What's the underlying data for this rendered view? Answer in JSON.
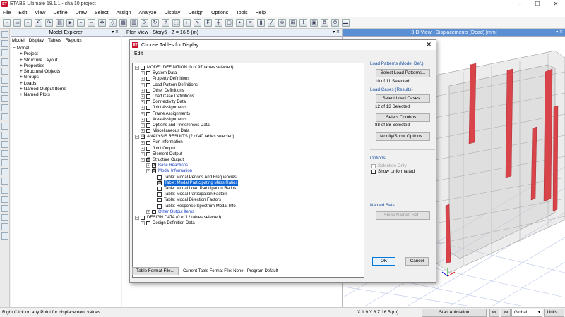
{
  "app": {
    "title": "ETABS Ultimate 18.1.1 - cha 10 project",
    "logo": "ET",
    "win": [
      "–",
      "☐",
      "✕"
    ]
  },
  "menu": [
    "File",
    "Edit",
    "View",
    "Define",
    "Draw",
    "Select",
    "Assign",
    "Analyze",
    "Display",
    "Design",
    "Options",
    "Tools",
    "Help"
  ],
  "toolbar": [
    "new-icon",
    "open-icon",
    "save-icon",
    "undo-icon",
    "redo-icon",
    "lock-icon",
    "run-icon",
    "zoom-in-icon",
    "zoom-out-icon",
    "pan-icon",
    "3d-icon",
    "plan-icon",
    "elevation-icon"
  ],
  "explorer": {
    "title": "Model Explorer",
    "tabs": [
      "Model",
      "Display",
      "Tables",
      "Reports"
    ],
    "items": [
      {
        "exp": "−",
        "label": "Model"
      },
      {
        "exp": "+",
        "label": "Project"
      },
      {
        "exp": "+",
        "label": "Structure Layout"
      },
      {
        "exp": "+",
        "label": "Properties"
      },
      {
        "exp": "+",
        "label": "Structural Objects"
      },
      {
        "exp": "+",
        "label": "Groups"
      },
      {
        "exp": "+",
        "label": "Loads"
      },
      {
        "exp": "+",
        "label": "Named Output Items"
      },
      {
        "exp": "+",
        "label": "Named Plots"
      }
    ]
  },
  "planview": {
    "title": "Plan View - Story5 - Z = 16.5 (m)"
  },
  "view3d": {
    "title": "3-D View  - Displacements (Dead)  [mm]"
  },
  "status": {
    "left": "Right Click on any Point for displacement values",
    "coords": "X 1.9  Y 8  Z 16.5 (m)",
    "animate": "Start Animation",
    "nav_prev": "<<",
    "nav_next": ">>",
    "cs": "Global",
    "units": "Units..."
  },
  "dialog": {
    "logo": "ET",
    "title": "Choose Tables for Display",
    "close": "✕",
    "menu": "Edit",
    "rows": [
      {
        "ind": 0,
        "exp": "−",
        "cb": "",
        "label": "MODEL DEFINITION  (0 of 97 tables selected)",
        "style": ""
      },
      {
        "ind": 1,
        "exp": "+",
        "cb": "",
        "label": "System Data",
        "style": ""
      },
      {
        "ind": 1,
        "exp": "+",
        "cb": "",
        "label": "Property Definitions",
        "style": ""
      },
      {
        "ind": 1,
        "exp": "+",
        "cb": "",
        "label": "Load Pattern Definitions",
        "style": ""
      },
      {
        "ind": 1,
        "exp": "+",
        "cb": "",
        "label": "Other Definitions",
        "style": ""
      },
      {
        "ind": 1,
        "exp": "+",
        "cb": "",
        "label": "Load Case Definitions",
        "style": ""
      },
      {
        "ind": 1,
        "exp": "+",
        "cb": "",
        "label": "Connectivity Data",
        "style": ""
      },
      {
        "ind": 1,
        "exp": "+",
        "cb": "",
        "label": "Joint Assignments",
        "style": ""
      },
      {
        "ind": 1,
        "exp": "+",
        "cb": "",
        "label": "Frame Assignments",
        "style": ""
      },
      {
        "ind": 1,
        "exp": "+",
        "cb": "",
        "label": "Area Assignments",
        "style": ""
      },
      {
        "ind": 1,
        "exp": "+",
        "cb": "",
        "label": "Options and Preferences Data",
        "style": ""
      },
      {
        "ind": 1,
        "exp": "+",
        "cb": "",
        "label": "Miscellaneous Data",
        "style": ""
      },
      {
        "ind": 0,
        "exp": "−",
        "cb": "☒",
        "label": "ANALYSIS RESULTS  (2 of 40 tables selected)",
        "style": ""
      },
      {
        "ind": 1,
        "exp": "+",
        "cb": "",
        "label": "Run Information",
        "style": ""
      },
      {
        "ind": 1,
        "exp": "+",
        "cb": "",
        "label": "Joint Output",
        "style": ""
      },
      {
        "ind": 1,
        "exp": "+",
        "cb": "",
        "label": "Element Output",
        "style": ""
      },
      {
        "ind": 1,
        "exp": "−",
        "cb": "☒",
        "label": "Structure Output",
        "style": ""
      },
      {
        "ind": 2,
        "exp": "+",
        "cb": "☒",
        "label": "Base Reactions",
        "style": "blue"
      },
      {
        "ind": 2,
        "exp": "−",
        "cb": "☒",
        "label": "Modal Information",
        "style": "blue"
      },
      {
        "ind": 3,
        "exp": "",
        "cb": "",
        "label": "Table:  Modal Periods And Frequencies",
        "style": ""
      },
      {
        "ind": 3,
        "exp": "",
        "cb": "☒",
        "label": "Table:  Modal Participating Mass Ratios",
        "style": "sel"
      },
      {
        "ind": 3,
        "exp": "",
        "cb": "",
        "label": "Table:  Modal Load Participation Ratios",
        "style": ""
      },
      {
        "ind": 3,
        "exp": "",
        "cb": "",
        "label": "Table:  Modal Participation Factors",
        "style": ""
      },
      {
        "ind": 3,
        "exp": "",
        "cb": "",
        "label": "Table:  Modal Direction Factors",
        "style": ""
      },
      {
        "ind": 3,
        "exp": "",
        "cb": "",
        "label": "Table:  Response Spectrum Modal Info",
        "style": ""
      },
      {
        "ind": 2,
        "exp": "+",
        "cb": "",
        "label": "Other Output Items",
        "style": "blue"
      },
      {
        "ind": 0,
        "exp": "−",
        "cb": "",
        "label": "DESIGN DATA  (0 of 12 tables selected)",
        "style": ""
      },
      {
        "ind": 1,
        "exp": "+",
        "cb": "",
        "label": "Design Definition Data",
        "style": ""
      }
    ],
    "load_patterns": {
      "heading": "Load Patterns (Model Def.)",
      "button": "Select Load Patterns...",
      "status": "10 of 11 Selected"
    },
    "load_cases": {
      "heading": "Load Cases (Results)",
      "button": "Select Load Cases...",
      "status": "12 of 13 Selected"
    },
    "combos": {
      "button": "Select Combos...",
      "status": "88 of 88 Selected"
    },
    "modify_button": "Modify/Show Options...",
    "options": {
      "heading": "Options",
      "selection_only": "Selection Only",
      "show_unformatted": "Show Unformatted"
    },
    "named_sets": {
      "heading": "Named Sets",
      "button": "Show Named Set..."
    },
    "ok": "OK",
    "cancel": "Cancel",
    "format_button": "Table Format File...",
    "current_format": "Current Table Format File:  None - Program Default"
  }
}
